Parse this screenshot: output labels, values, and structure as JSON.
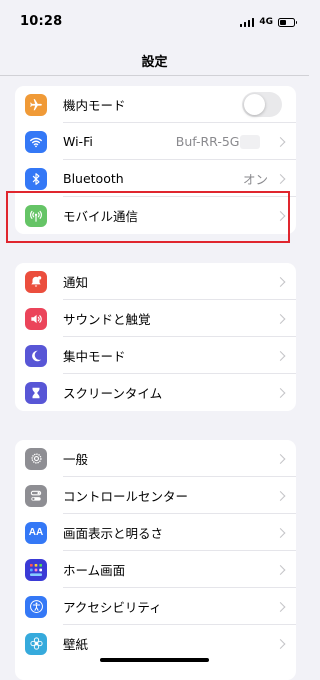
{
  "status": {
    "time": "10:28",
    "network": "4G"
  },
  "nav": {
    "title": "設定"
  },
  "group1": [
    {
      "label": "機内モード",
      "icon": "airplane-icon",
      "color": "#f09a37"
    },
    {
      "label": "Wi-Fi",
      "value": "Buf-RR-5G-",
      "icon": "wifi-icon",
      "color": "#3478f6"
    },
    {
      "label": "Bluetooth",
      "value": "オン",
      "icon": "bluetooth-icon",
      "color": "#3478f6"
    },
    {
      "label": "モバイル通信",
      "icon": "antenna-icon",
      "color": "#65c466"
    }
  ],
  "group2": [
    {
      "label": "通知",
      "icon": "bell-icon",
      "color": "#eb4e3d"
    },
    {
      "label": "サウンドと触覚",
      "icon": "speaker-icon",
      "color": "#eb445a"
    },
    {
      "label": "集中モード",
      "icon": "moon-icon",
      "color": "#5856d6"
    },
    {
      "label": "スクリーンタイム",
      "icon": "hourglass-icon",
      "color": "#5856d6"
    }
  ],
  "group3": [
    {
      "label": "一般",
      "icon": "gear-icon",
      "color": "#8e8e93"
    },
    {
      "label": "コントロールセンター",
      "icon": "toggles-icon",
      "color": "#8e8e93"
    },
    {
      "label": "画面表示と明るさ",
      "icon": "text-size-icon",
      "icon_text": "AA",
      "color": "#3478f6"
    },
    {
      "label": "ホーム画面",
      "icon": "home-grid-icon",
      "color": "#3a3ad6"
    },
    {
      "label": "アクセシビリティ",
      "icon": "accessibility-icon",
      "color": "#3478f6"
    },
    {
      "label": "壁紙",
      "icon": "flower-icon",
      "color": "#36aadc"
    }
  ],
  "highlight_color": "#e0262e"
}
